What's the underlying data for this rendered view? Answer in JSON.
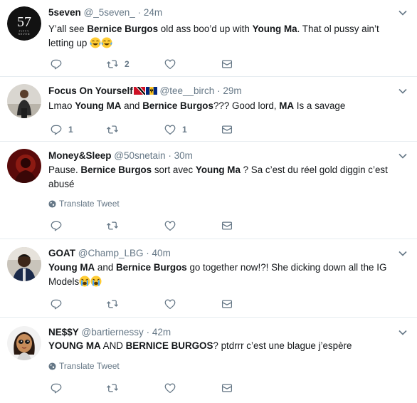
{
  "tweets": [
    {
      "name": "5seven",
      "handle": "@_5seven_",
      "dot": "·",
      "time": "24m",
      "text_parts": [
        "Y’all see ",
        "Bernice Burgos",
        " old ass boo’d up with ",
        "Young Ma",
        ". That ol pussy ain’t letting up "
      ],
      "reply_count": "",
      "retweet_count": "2",
      "like_count": ""
    },
    {
      "name": "Focus On Yourself",
      "handle": "@tee__birch",
      "dot": "·",
      "time": "29m",
      "text_parts": [
        "Lmao ",
        "Young MA",
        " and ",
        "Bernice Burgos",
        "??? Good lord, ",
        "MA",
        " Is a savage"
      ],
      "reply_count": "1",
      "retweet_count": "",
      "like_count": "1"
    },
    {
      "name": "Money&Sleep",
      "handle": "@50snetain",
      "dot": "·",
      "time": "30m",
      "text_parts": [
        "Pause. ",
        "Bernice Burgos",
        " sort avec ",
        "Young Ma",
        " ? Sa c’est du réel gold diggin c’est abusé"
      ],
      "translate_label": "Translate Tweet",
      "reply_count": "",
      "retweet_count": "",
      "like_count": ""
    },
    {
      "name": "GOAT",
      "handle": "@Champ_LBG",
      "dot": "·",
      "time": "40m",
      "text_parts": [
        "Young MA",
        " and ",
        "Bernice Burgos",
        " go together now!?! She dicking down all the IG Models"
      ],
      "reply_count": "",
      "retweet_count": "",
      "like_count": ""
    },
    {
      "name": "NE$$Y",
      "handle": "@bartiernessy",
      "dot": "·",
      "time": "42m",
      "text_parts": [
        "YOUNG MA",
        " AND ",
        "BERNICE BURGOS",
        "? ptdrrr c’est une blague j’espère"
      ],
      "translate_label": "Translate Tweet",
      "reply_count": "",
      "retweet_count": "",
      "like_count": ""
    }
  ],
  "icons": {
    "reply": "reply-icon",
    "retweet": "retweet-icon",
    "like": "heart-icon",
    "dm": "envelope-icon",
    "caret": "chevron-down-icon",
    "globe": "globe-icon"
  },
  "colors": {
    "text": "#14171a",
    "secondary": "#657786",
    "divider": "#e6ecf0"
  }
}
